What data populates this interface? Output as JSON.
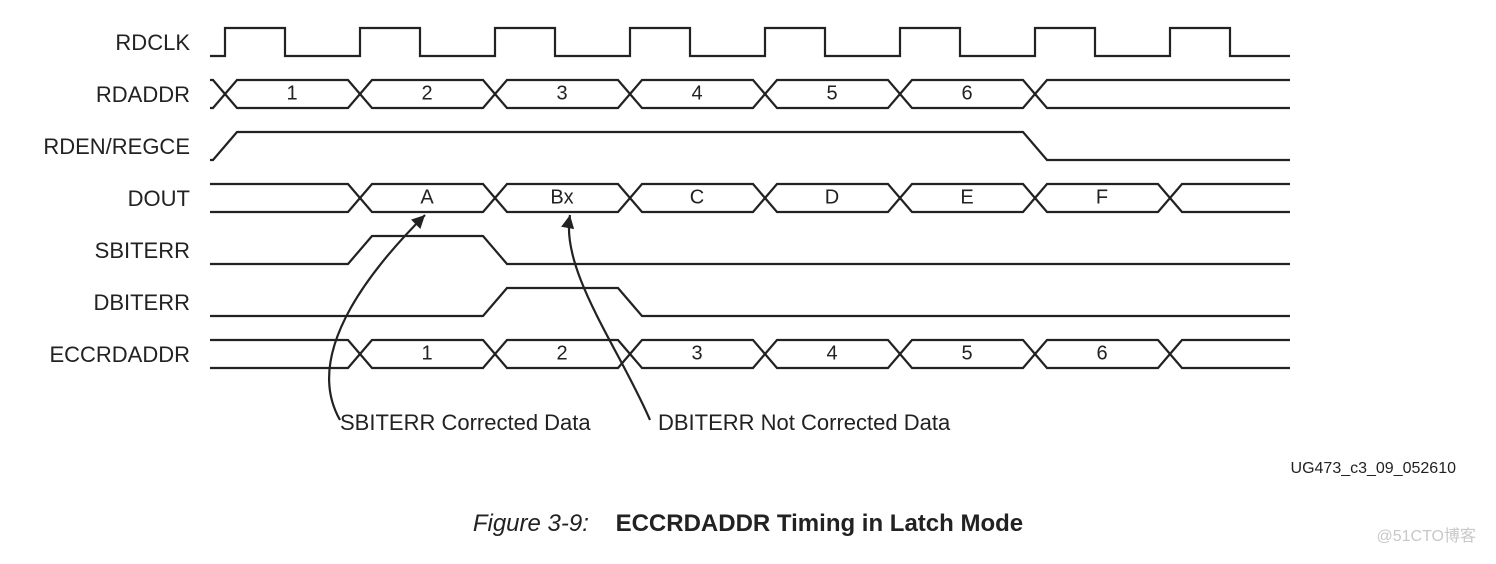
{
  "signals": {
    "rdclk": "RDCLK",
    "rdaddr": "RDADDR",
    "rden": "RDEN/REGCE",
    "dout": "DOUT",
    "sbiterr": "SBITERR",
    "dbiterr": "DBITERR",
    "eccrdaddr": "ECCRDADDR"
  },
  "rdaddr_cells": [
    "1",
    "2",
    "3",
    "4",
    "5",
    "6"
  ],
  "dout_cells": [
    "A",
    "Bx",
    "C",
    "D",
    "E",
    "F"
  ],
  "eccrdaddr_cells": [
    "1",
    "2",
    "3",
    "4",
    "5",
    "6"
  ],
  "annot_sbiterr": "SBITERR Corrected Data",
  "annot_dbiterr": "DBITERR Not Corrected Data",
  "doc_id": "UG473_c3_09_052610",
  "caption_fig": "Figure 3-9:",
  "caption_title": "ECCRDADDR Timing in Latch Mode",
  "watermark": "@51CTO博客",
  "chart_data": {
    "type": "timing-diagram",
    "title": "ECCRDADDR Timing in Latch Mode",
    "clock": {
      "name": "RDCLK",
      "cycles": 8
    },
    "signals": [
      {
        "name": "RDADDR",
        "type": "bus",
        "values_by_cycle": [
          "",
          "1",
          "2",
          "3",
          "4",
          "5",
          "6",
          ""
        ]
      },
      {
        "name": "RDEN/REGCE",
        "type": "level",
        "high_cycles": [
          1,
          2,
          3,
          4,
          5,
          6
        ],
        "low_cycles": [
          0,
          7
        ]
      },
      {
        "name": "DOUT",
        "type": "bus",
        "values_by_cycle": [
          "",
          "",
          "A",
          "Bx",
          "C",
          "D",
          "E",
          "F"
        ]
      },
      {
        "name": "SBITERR",
        "type": "pulse",
        "high_cycles": [
          2
        ]
      },
      {
        "name": "DBITERR",
        "type": "pulse",
        "high_cycles": [
          3
        ]
      },
      {
        "name": "ECCRDADDR",
        "type": "bus",
        "values_by_cycle": [
          "",
          "",
          "1",
          "2",
          "3",
          "4",
          "5",
          "6"
        ]
      }
    ],
    "annotations": [
      {
        "target_signal": "DOUT",
        "target_value": "A",
        "text": "SBITERR Corrected Data"
      },
      {
        "target_signal": "DOUT",
        "target_value": "Bx",
        "text": "DBITERR Not Corrected Data"
      }
    ]
  }
}
